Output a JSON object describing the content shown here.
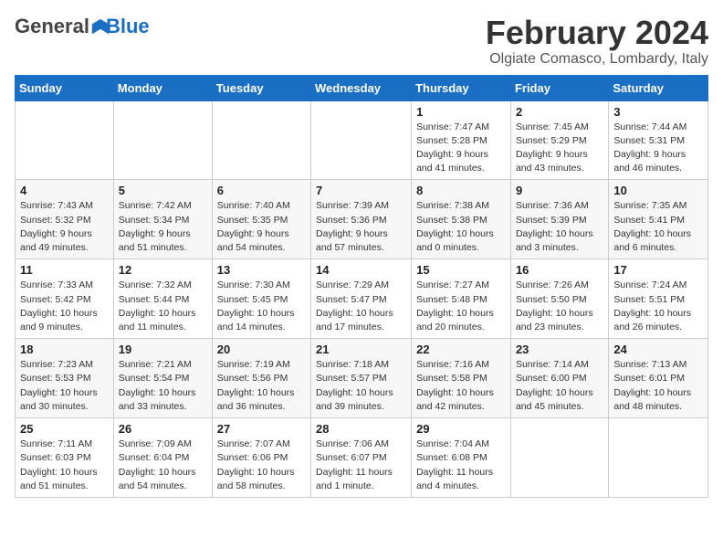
{
  "app": {
    "logo_general": "General",
    "logo_blue": "Blue"
  },
  "header": {
    "month_year": "February 2024",
    "location": "Olgiate Comasco, Lombardy, Italy"
  },
  "columns": [
    "Sunday",
    "Monday",
    "Tuesday",
    "Wednesday",
    "Thursday",
    "Friday",
    "Saturday"
  ],
  "weeks": [
    [
      {
        "day": "",
        "info": ""
      },
      {
        "day": "",
        "info": ""
      },
      {
        "day": "",
        "info": ""
      },
      {
        "day": "",
        "info": ""
      },
      {
        "day": "1",
        "info": "Sunrise: 7:47 AM\nSunset: 5:28 PM\nDaylight: 9 hours\nand 41 minutes."
      },
      {
        "day": "2",
        "info": "Sunrise: 7:45 AM\nSunset: 5:29 PM\nDaylight: 9 hours\nand 43 minutes."
      },
      {
        "day": "3",
        "info": "Sunrise: 7:44 AM\nSunset: 5:31 PM\nDaylight: 9 hours\nand 46 minutes."
      }
    ],
    [
      {
        "day": "4",
        "info": "Sunrise: 7:43 AM\nSunset: 5:32 PM\nDaylight: 9 hours\nand 49 minutes."
      },
      {
        "day": "5",
        "info": "Sunrise: 7:42 AM\nSunset: 5:34 PM\nDaylight: 9 hours\nand 51 minutes."
      },
      {
        "day": "6",
        "info": "Sunrise: 7:40 AM\nSunset: 5:35 PM\nDaylight: 9 hours\nand 54 minutes."
      },
      {
        "day": "7",
        "info": "Sunrise: 7:39 AM\nSunset: 5:36 PM\nDaylight: 9 hours\nand 57 minutes."
      },
      {
        "day": "8",
        "info": "Sunrise: 7:38 AM\nSunset: 5:38 PM\nDaylight: 10 hours\nand 0 minutes."
      },
      {
        "day": "9",
        "info": "Sunrise: 7:36 AM\nSunset: 5:39 PM\nDaylight: 10 hours\nand 3 minutes."
      },
      {
        "day": "10",
        "info": "Sunrise: 7:35 AM\nSunset: 5:41 PM\nDaylight: 10 hours\nand 6 minutes."
      }
    ],
    [
      {
        "day": "11",
        "info": "Sunrise: 7:33 AM\nSunset: 5:42 PM\nDaylight: 10 hours\nand 9 minutes."
      },
      {
        "day": "12",
        "info": "Sunrise: 7:32 AM\nSunset: 5:44 PM\nDaylight: 10 hours\nand 11 minutes."
      },
      {
        "day": "13",
        "info": "Sunrise: 7:30 AM\nSunset: 5:45 PM\nDaylight: 10 hours\nand 14 minutes."
      },
      {
        "day": "14",
        "info": "Sunrise: 7:29 AM\nSunset: 5:47 PM\nDaylight: 10 hours\nand 17 minutes."
      },
      {
        "day": "15",
        "info": "Sunrise: 7:27 AM\nSunset: 5:48 PM\nDaylight: 10 hours\nand 20 minutes."
      },
      {
        "day": "16",
        "info": "Sunrise: 7:26 AM\nSunset: 5:50 PM\nDaylight: 10 hours\nand 23 minutes."
      },
      {
        "day": "17",
        "info": "Sunrise: 7:24 AM\nSunset: 5:51 PM\nDaylight: 10 hours\nand 26 minutes."
      }
    ],
    [
      {
        "day": "18",
        "info": "Sunrise: 7:23 AM\nSunset: 5:53 PM\nDaylight: 10 hours\nand 30 minutes."
      },
      {
        "day": "19",
        "info": "Sunrise: 7:21 AM\nSunset: 5:54 PM\nDaylight: 10 hours\nand 33 minutes."
      },
      {
        "day": "20",
        "info": "Sunrise: 7:19 AM\nSunset: 5:56 PM\nDaylight: 10 hours\nand 36 minutes."
      },
      {
        "day": "21",
        "info": "Sunrise: 7:18 AM\nSunset: 5:57 PM\nDaylight: 10 hours\nand 39 minutes."
      },
      {
        "day": "22",
        "info": "Sunrise: 7:16 AM\nSunset: 5:58 PM\nDaylight: 10 hours\nand 42 minutes."
      },
      {
        "day": "23",
        "info": "Sunrise: 7:14 AM\nSunset: 6:00 PM\nDaylight: 10 hours\nand 45 minutes."
      },
      {
        "day": "24",
        "info": "Sunrise: 7:13 AM\nSunset: 6:01 PM\nDaylight: 10 hours\nand 48 minutes."
      }
    ],
    [
      {
        "day": "25",
        "info": "Sunrise: 7:11 AM\nSunset: 6:03 PM\nDaylight: 10 hours\nand 51 minutes."
      },
      {
        "day": "26",
        "info": "Sunrise: 7:09 AM\nSunset: 6:04 PM\nDaylight: 10 hours\nand 54 minutes."
      },
      {
        "day": "27",
        "info": "Sunrise: 7:07 AM\nSunset: 6:06 PM\nDaylight: 10 hours\nand 58 minutes."
      },
      {
        "day": "28",
        "info": "Sunrise: 7:06 AM\nSunset: 6:07 PM\nDaylight: 11 hours\nand 1 minute."
      },
      {
        "day": "29",
        "info": "Sunrise: 7:04 AM\nSunset: 6:08 PM\nDaylight: 11 hours\nand 4 minutes."
      },
      {
        "day": "",
        "info": ""
      },
      {
        "day": "",
        "info": ""
      }
    ]
  ]
}
